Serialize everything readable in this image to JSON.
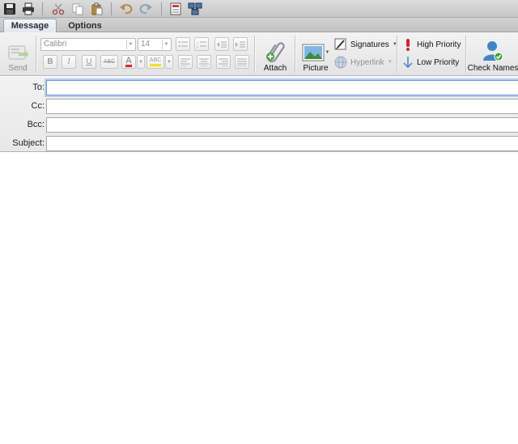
{
  "quick_access": {
    "icons": [
      "save-icon",
      "print-icon",
      "cut-icon",
      "copy-icon",
      "paste-icon",
      "undo-icon",
      "redo-icon",
      "insert-table-icon",
      "network-icon"
    ]
  },
  "tabs": [
    {
      "label": "Message",
      "active": true
    },
    {
      "label": "Options",
      "active": false
    }
  ],
  "ribbon": {
    "send_label": "Send",
    "font_name": "Calibri",
    "font_size": "14",
    "format_buttons": {
      "bold": "B",
      "italic": "I",
      "underline": "U",
      "strike": "ABC",
      "color": "A",
      "highlight": "ABC"
    },
    "attach_label": "Attach",
    "picture_label": "Picture",
    "signatures_label": "Signatures",
    "hyperlink_label": "Hyperlink",
    "high_priority_label": "High Priority",
    "low_priority_label": "Low Priority",
    "check_names_label": "Check Names"
  },
  "fields": {
    "to_label": "To:",
    "cc_label": "Cc:",
    "bcc_label": "Bcc:",
    "subject_label": "Subject:",
    "to_value": "",
    "cc_value": "",
    "bcc_value": "",
    "subject_value": ""
  },
  "colors": {
    "focus_border": "#6f9ad8",
    "font_color_underline": "#d62b2b",
    "highlight_underline": "#f2e21d",
    "high_priority": "#d0271f",
    "low_priority": "#3f7fd6"
  }
}
